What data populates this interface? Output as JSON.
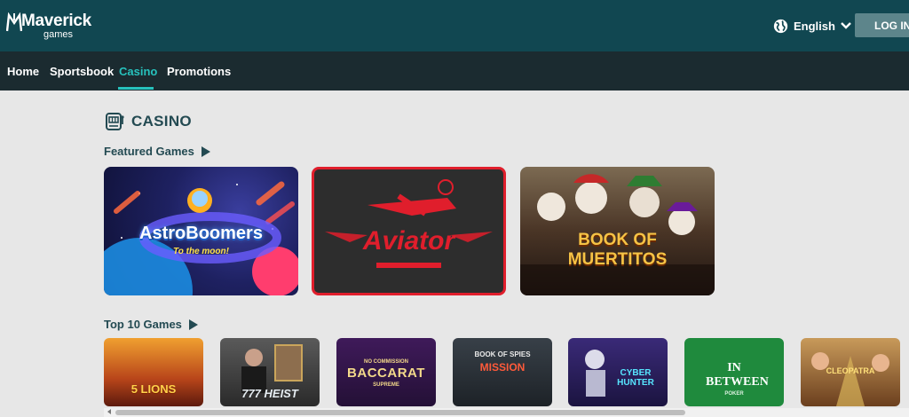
{
  "header": {
    "logo_word1": "Maverick",
    "logo_word2": "games",
    "language": "English",
    "login_label": "LOG IN"
  },
  "nav": {
    "items": [
      {
        "label": "Home"
      },
      {
        "label": "Sportsbook"
      },
      {
        "label": "Casino",
        "active": true
      },
      {
        "label": "Promotions"
      }
    ]
  },
  "page": {
    "title": "CASINO",
    "featured_title": "Featured Games",
    "top10_title": "Top 10 Games"
  },
  "featured": [
    {
      "name": "AstroBoomers",
      "subtitle": "To the moon!"
    },
    {
      "name": "Aviator"
    },
    {
      "name": "BOOK OF MUERTITOS"
    }
  ],
  "top10": [
    {
      "name": "5 LIONS"
    },
    {
      "name": "777 HEIST"
    },
    {
      "name": "BACCARAT",
      "top": "NO COMMISSION",
      "bottom": "SUPREME"
    },
    {
      "name": "MISSION",
      "top": "BOOK OF SPIES"
    },
    {
      "name": "CYBER HUNTER"
    },
    {
      "name": "IN BETWEEN",
      "bottom": "POKER"
    },
    {
      "name": "CLEOPATRA"
    }
  ],
  "colors": {
    "header_bg": "#114751",
    "nav_bg": "#1b2b30",
    "accent": "#27c2bd",
    "page_bg": "#e7e7e7",
    "heading": "#234a52",
    "login_bg": "#5d858b"
  },
  "icons": {
    "language": "globe-icon",
    "dropdown": "chevron-down-icon",
    "section": "slot-machine-icon",
    "row_more": "play-arrow-icon"
  }
}
